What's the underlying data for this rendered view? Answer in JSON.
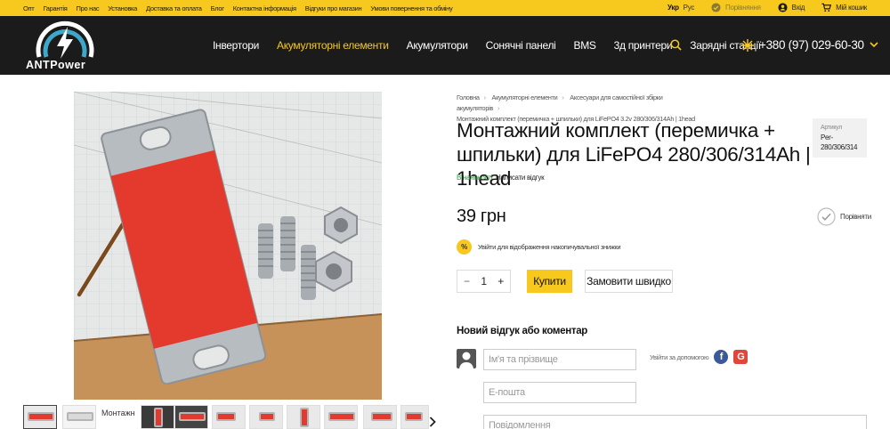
{
  "topbar": {
    "links": [
      "Опт",
      "Гарантія",
      "Про нас",
      "Установка",
      "Доставка та оплата",
      "Блог",
      "Контактна інформація",
      "Відгуки про магазин",
      "Умови повернення та обміну"
    ],
    "lang_active": "Укр",
    "lang_other": "Рус",
    "compare": "Порівняння",
    "login": "Вхід",
    "cart": "Мій кошик"
  },
  "header": {
    "logo_text": "ANTPower",
    "nav": [
      "Інвертори",
      "Акумуляторні елементи",
      "Акумулятори",
      "Сонячні панелі",
      "BMS",
      "3д принтери",
      "Зарядні станції"
    ],
    "nav_active_index": 1,
    "phone": "+380 (97) 029-60-30"
  },
  "breadcrumb": {
    "items": [
      "Головна",
      "Акумуляторні елементи",
      "Аксесуари для самостійної збірки акумуляторів"
    ],
    "current": "Монтажний комплект (перемичка + шпильки) для LiFePO4 3.2v 280/306/314Ah | 1head"
  },
  "product": {
    "title": "Монтажний комплект (перемичка + шпильки) для LiFePO4 280/306/314Ah | 1head",
    "sku_label": "Артикул",
    "sku": "Per-280/306/314",
    "stock": "В наявності",
    "review_link": "Написати відгук",
    "price": "39 грн",
    "compare": "Порівняти",
    "discount_icon": "%",
    "discount_text": "Увійти для відображення накопичувальної знижки",
    "qty": "1",
    "qty_minus": "−",
    "qty_plus": "+",
    "buy": "Купити",
    "quick": "Замовити швидко"
  },
  "thumb_alt": "Монтажн",
  "reviews": {
    "title": "Новий відгук або коментар",
    "name_placeholder": "Ім'я та прізвище",
    "email_placeholder": "E-пошта",
    "message_placeholder": "Повідомлення",
    "social_label": "Увійти за допомогою",
    "fb": "f",
    "google": "G"
  },
  "colors": {
    "accent": "#f7c81e",
    "header_bg": "#1b1b1b",
    "stock_green": "#2a9a3c"
  }
}
